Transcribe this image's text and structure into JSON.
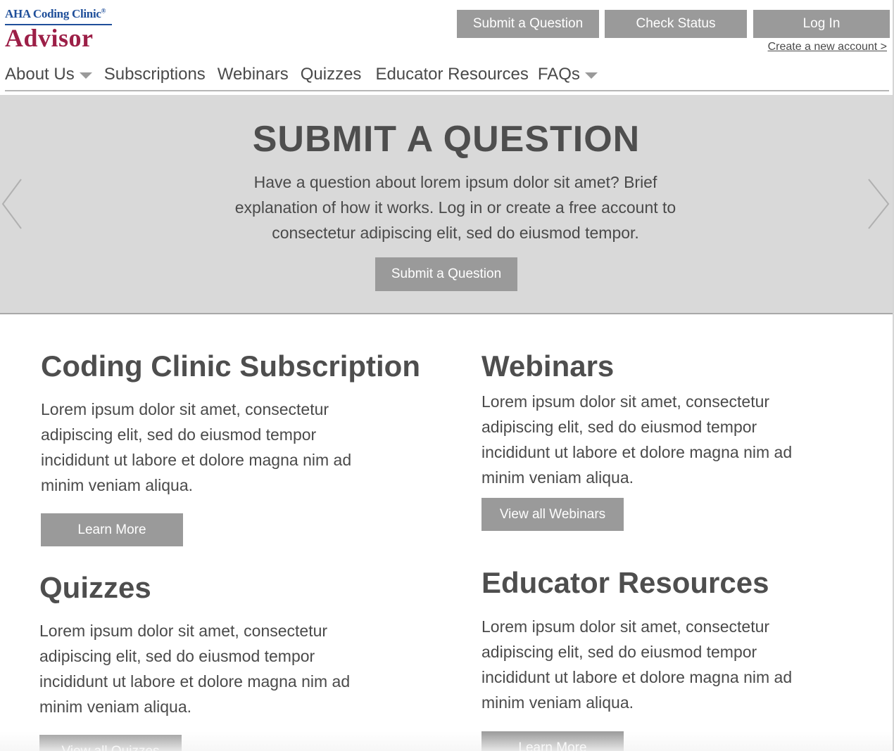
{
  "logo": {
    "line1_aha": "AHA",
    "line1_rest": "Coding Clinic",
    "line1_mark": "®",
    "main": "Advisor"
  },
  "header": {
    "submit_question": "Submit a Question",
    "check_status": "Check Status",
    "log_in": "Log In",
    "create_account": "Create a new account >"
  },
  "nav": {
    "items": [
      {
        "label": "About Us",
        "has_dropdown": true
      },
      {
        "label": "Subscriptions",
        "has_dropdown": false
      },
      {
        "label": "Webinars",
        "has_dropdown": false
      },
      {
        "label": "Quizzes",
        "has_dropdown": false
      },
      {
        "label": "Educator Resources",
        "has_dropdown": false
      },
      {
        "label": "FAQs",
        "has_dropdown": true
      }
    ]
  },
  "hero": {
    "title": "SUBMIT A QUESTION",
    "text": "Have a question about lorem ipsum dolor sit amet? Brief explanation of how it works. Log in or create a free account to consectetur adipiscing elit, sed do eiusmod tempor.",
    "button": "Submit a Question",
    "prev_icon": "chevron-left-icon",
    "next_icon": "chevron-right-icon"
  },
  "sections": [
    {
      "title": "Coding Clinic Subscription",
      "body": "Lorem ipsum dolor sit amet, consectetur adipiscing elit, sed do eiusmod tempor incididunt ut labore et dolore magna nim ad minim veniam aliqua.",
      "button": "Learn More"
    },
    {
      "title": "Webinars",
      "body": "Lorem ipsum dolor sit amet, consectetur adipiscing elit, sed do eiusmod tempor incididunt ut labore et dolore magna nim ad minim veniam aliqua.",
      "button": "View all Webinars"
    },
    {
      "title": "Quizzes",
      "body": "Lorem ipsum dolor sit amet, consectetur adipiscing elit, sed do eiusmod tempor incididunt ut labore et dolore magna nim ad minim veniam aliqua.",
      "button": "View all Quizzes"
    },
    {
      "title": "Educator Resources",
      "body": "Lorem ipsum dolor sit amet, consectetur adipiscing elit, sed do eiusmod tempor incididunt ut labore et dolore magna nim ad minim veniam aliqua.",
      "button": "Learn More"
    }
  ],
  "colors": {
    "button_gray": "#9a9a9a",
    "hero_bg": "#d9d9d9",
    "logo_blue": "#1f4f9a",
    "logo_red": "#9c1f47",
    "text_dark": "#4a4a4a"
  }
}
